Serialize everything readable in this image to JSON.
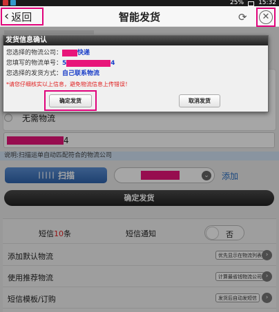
{
  "status_bar": {
    "battery": "25%",
    "time": "15:32"
  },
  "header": {
    "back_label": "返回",
    "title": "智能发货",
    "back_icon": "chevron-left-icon",
    "refresh_icon": "refresh-icon",
    "close_icon": "close-circle-icon"
  },
  "form": {
    "radio_no_logistics": "无需物流",
    "tracking_suffix": "4",
    "hint": "说明:扫描运单自动匹配符合的物流公司",
    "scan_label": "扫描",
    "add_label": "添加",
    "confirm_label": "确定发货"
  },
  "settings": {
    "sms_prefix": "短信",
    "sms_count": "10",
    "sms_unit": "条",
    "sms_notify": "短信通知",
    "toggle_label": "否",
    "rows": [
      {
        "title": "添加默认物流",
        "tag": "优先显示在物流列表"
      },
      {
        "title": "使用推荐物流",
        "tag": "计算最省钱物流公司"
      },
      {
        "title": "短信模板/订购",
        "tag": "发货后自动发短信"
      }
    ]
  },
  "dialog": {
    "title": "发货信息确认",
    "company_label": "您选择的物流公司：",
    "company_suffix": "快递",
    "tracking_label": "您填写的物流单号：",
    "tracking_prefix": "5",
    "tracking_suffix": "4",
    "method_label": "您选择的发货方式：",
    "method_value": "自己联系物流",
    "warning": "*请您仔细核实以上信息，避免物流信息上传错误！",
    "ok_label": "确定发货",
    "cancel_label": "取消发货"
  },
  "colors": {
    "highlight": "#e0007a",
    "redaction": "#e8157a",
    "link": "#2a6fc4",
    "dialog_value": "#1a3ec8",
    "warning": "#e02020"
  }
}
